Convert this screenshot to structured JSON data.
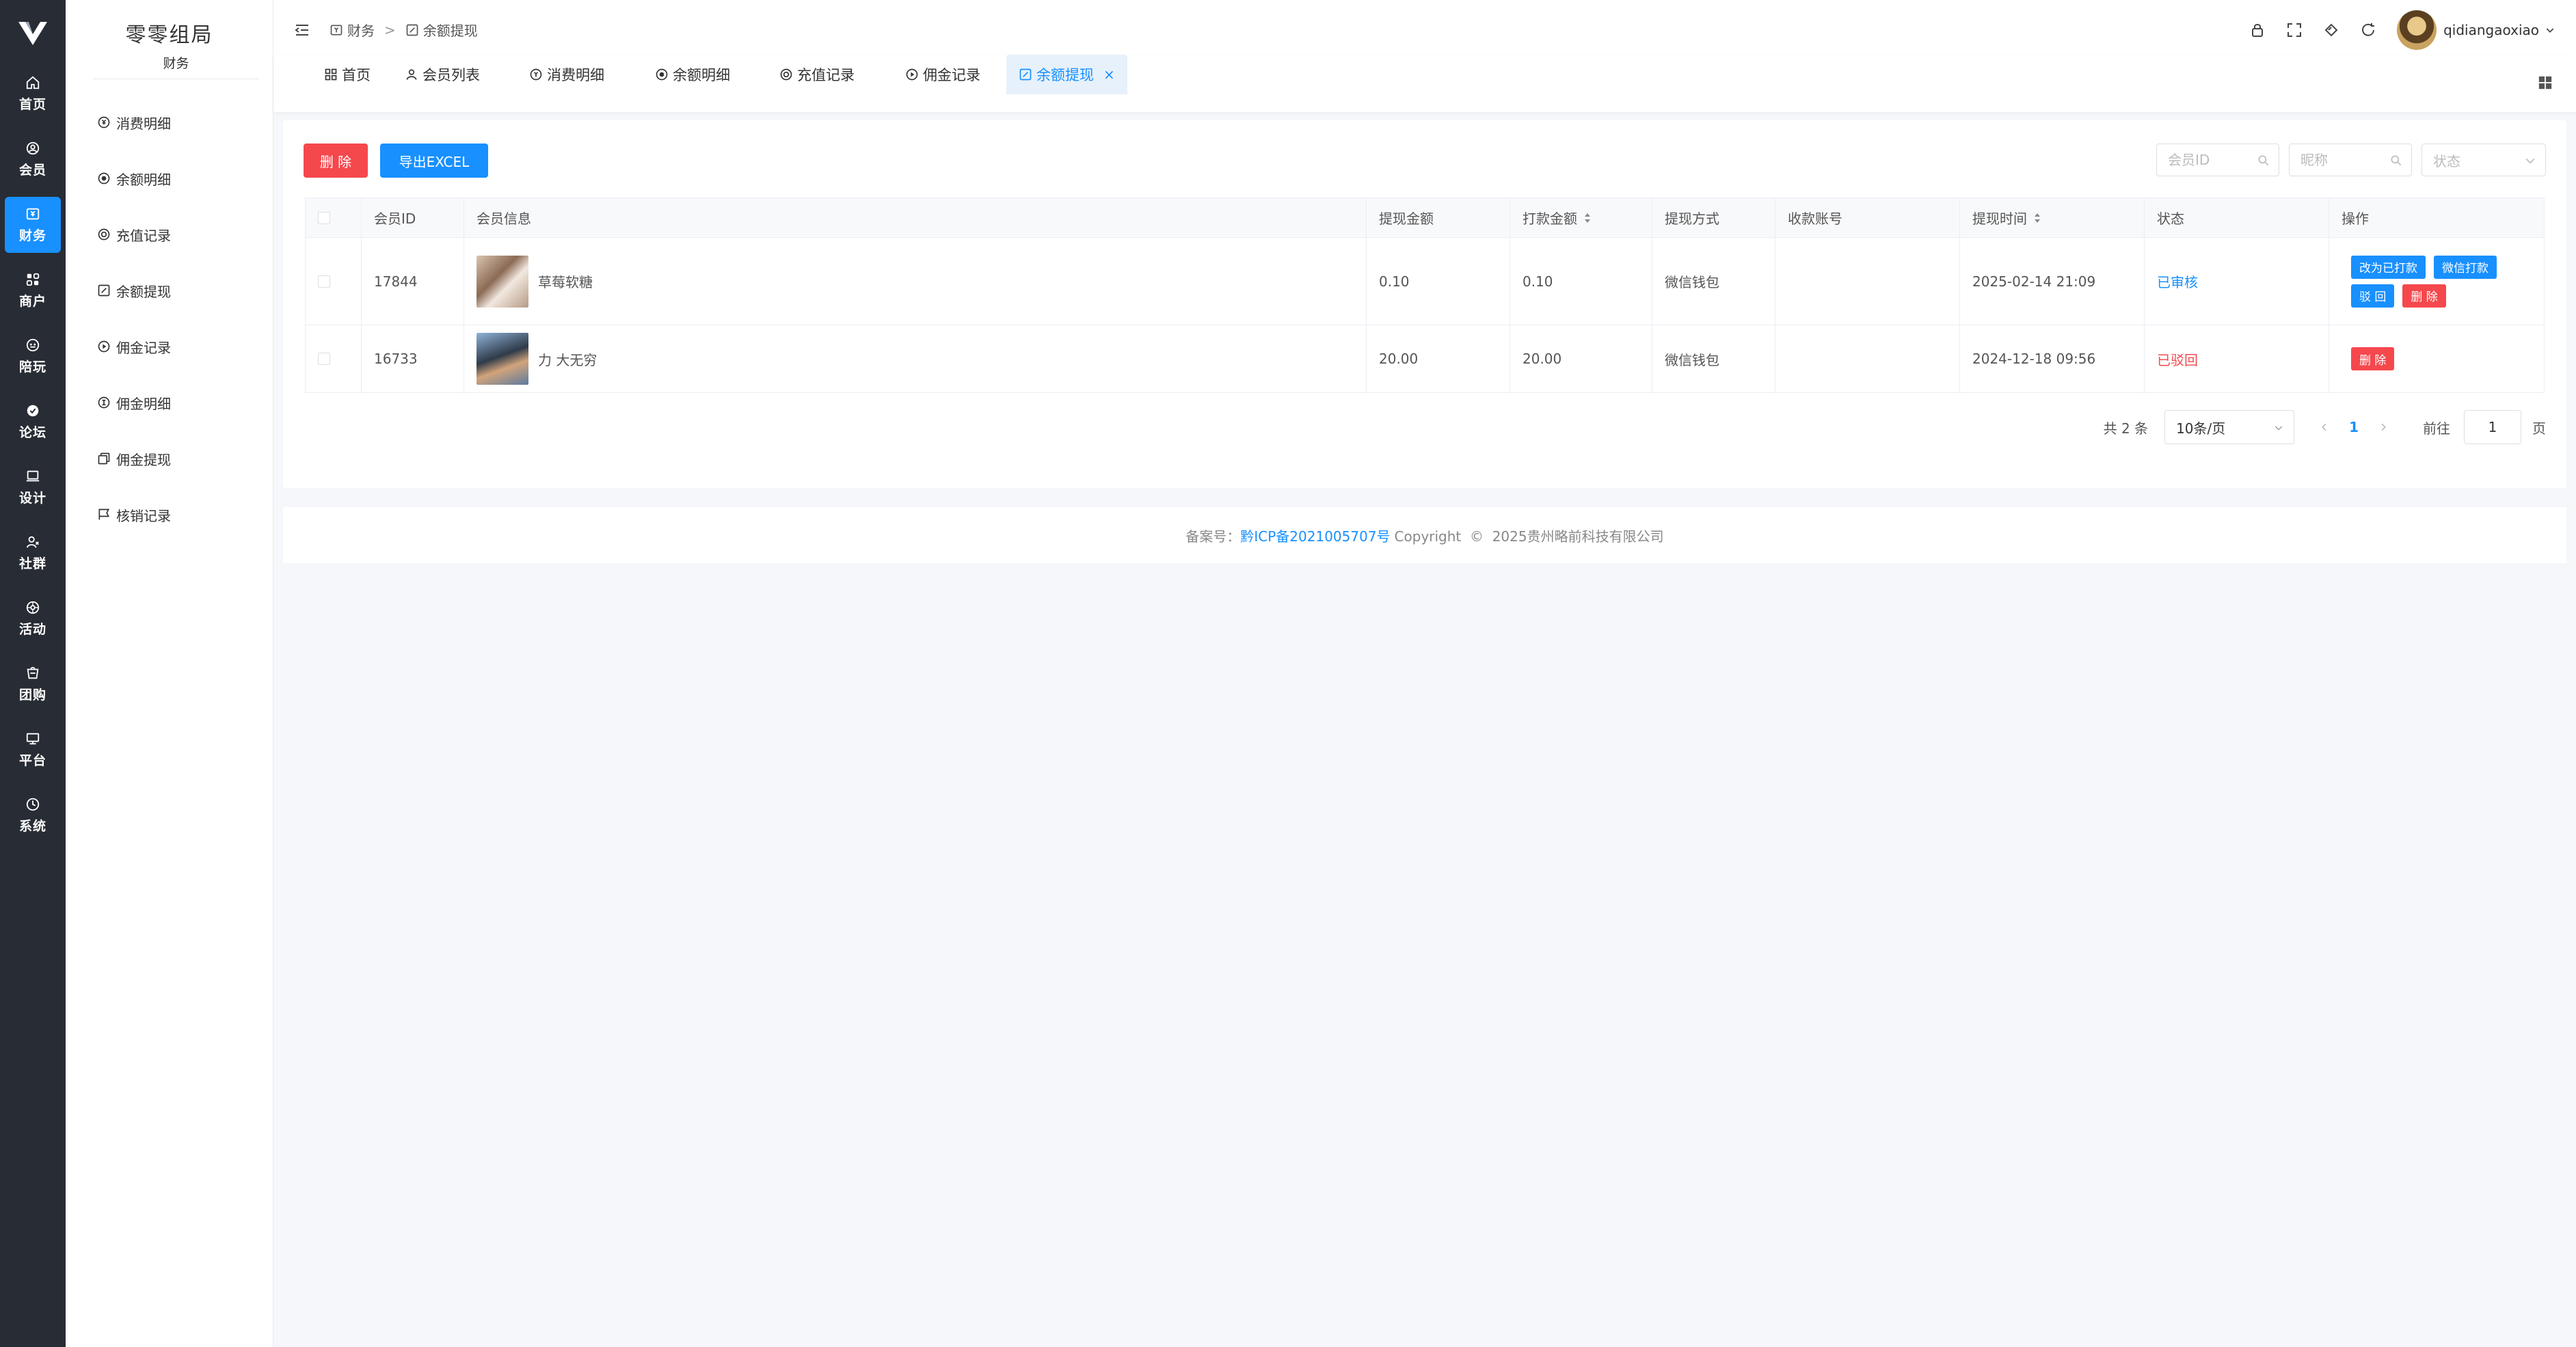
{
  "nav": {
    "items": [
      {
        "label": "首页",
        "icon": "home-icon"
      },
      {
        "label": "会员",
        "icon": "user-circle-icon"
      },
      {
        "label": "财务",
        "icon": "finance-icon"
      },
      {
        "label": "商户",
        "icon": "merchant-icon"
      },
      {
        "label": "陪玩",
        "icon": "gamepad-icon"
      },
      {
        "label": "论坛",
        "icon": "forum-icon"
      },
      {
        "label": "设计",
        "icon": "monitor-icon"
      },
      {
        "label": "社群",
        "icon": "community-icon"
      },
      {
        "label": "活动",
        "icon": "activity-icon"
      },
      {
        "label": "团购",
        "icon": "group-buy-icon"
      },
      {
        "label": "平台",
        "icon": "platform-icon"
      },
      {
        "label": "系统",
        "icon": "system-icon"
      }
    ],
    "active_index": 2
  },
  "submenu": {
    "title": "零零组局",
    "subtitle": "财务",
    "items": [
      "消费明细",
      "余额明细",
      "充值记录",
      "余额提现",
      "佣金记录",
      "佣金明细",
      "佣金提现",
      "核销记录"
    ]
  },
  "header": {
    "breadcrumb": [
      "财务",
      "余额提现"
    ],
    "breadcrumb_sep": ">",
    "username": "qidiangaoxiao"
  },
  "tabs": [
    {
      "label": "首页"
    },
    {
      "label": "会员列表"
    },
    {
      "label": "消费明细"
    },
    {
      "label": "余额明细"
    },
    {
      "label": "充值记录"
    },
    {
      "label": "佣金记录"
    },
    {
      "label": "余额提现",
      "active": true
    }
  ],
  "tab_close": "×",
  "toolbar": {
    "delete_label": "删 除",
    "export_label": "导出EXCEL"
  },
  "filters": {
    "member_id_placeholder": "会员ID",
    "nickname_placeholder": "昵称",
    "status_placeholder": "状态"
  },
  "table": {
    "columns": [
      "会员ID",
      "会员信息",
      "提现金额",
      "打款金额",
      "提现方式",
      "收款账号",
      "提现时间",
      "状态",
      "操作"
    ],
    "rows": [
      {
        "member_id": "17844",
        "nickname": "草莓软糖",
        "amount": "0.10",
        "paid": "0.10",
        "method": "微信钱包",
        "account": "",
        "time": "2025-02-14 21:09",
        "status": "已审核",
        "actions": [
          "改为已打款",
          "微信打款",
          "驳 回",
          "删 除"
        ]
      },
      {
        "member_id": "16733",
        "nickname": "力 大无穷",
        "amount": "20.00",
        "paid": "20.00",
        "method": "微信钱包",
        "account": "",
        "time": "2024-12-18 09:56",
        "status": "已驳回",
        "actions": [
          "删 除"
        ]
      }
    ]
  },
  "pagination": {
    "total": "共 2 条",
    "page_size": "10条/页",
    "current": "1",
    "goto_label": "前往",
    "goto_value": "1",
    "page_suffix": "页"
  },
  "footer": {
    "prefix": "备案号：",
    "icp": "黔ICP备2021005707号",
    "copyright": "Copyright  ©  2025贵州略前科技有限公司"
  },
  "colors": {
    "primary": "#1890ff",
    "danger": "#f5484d",
    "sidebar": "#282c34"
  }
}
